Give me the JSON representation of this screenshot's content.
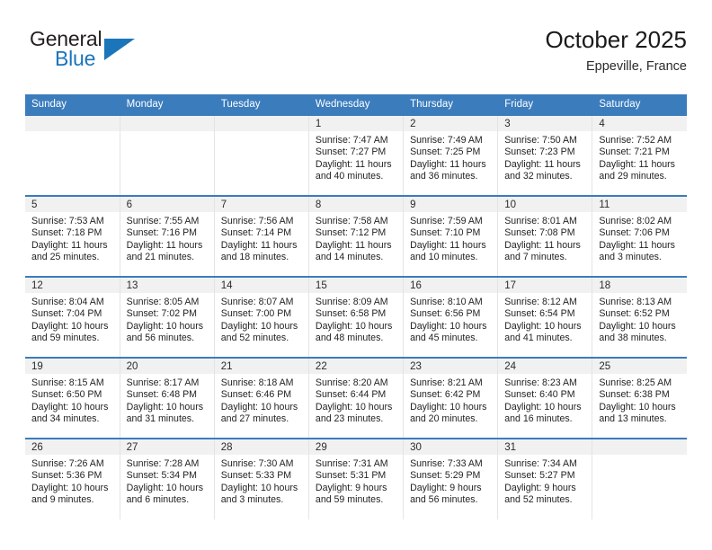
{
  "brand": {
    "name_top": "General",
    "name_bottom": "Blue",
    "color_dark": "#231f20",
    "color_blue": "#1b75bb"
  },
  "header": {
    "title": "October 2025",
    "subtitle": "Eppeville, France"
  },
  "theme": {
    "header_bg": "#3b7cbd",
    "header_text": "#ffffff",
    "daynum_band_bg": "#f1f1f1",
    "cell_bg": "#ffffff",
    "row_border": "#3b7cbd",
    "col_border": "#e4e4e4"
  },
  "weekdays": [
    "Sunday",
    "Monday",
    "Tuesday",
    "Wednesday",
    "Thursday",
    "Friday",
    "Saturday"
  ],
  "weeks": [
    [
      {
        "day": ""
      },
      {
        "day": ""
      },
      {
        "day": ""
      },
      {
        "day": "1",
        "sunrise": "Sunrise: 7:47 AM",
        "sunset": "Sunset: 7:27 PM",
        "daylight_l1": "Daylight: 11 hours",
        "daylight_l2": "and 40 minutes."
      },
      {
        "day": "2",
        "sunrise": "Sunrise: 7:49 AM",
        "sunset": "Sunset: 7:25 PM",
        "daylight_l1": "Daylight: 11 hours",
        "daylight_l2": "and 36 minutes."
      },
      {
        "day": "3",
        "sunrise": "Sunrise: 7:50 AM",
        "sunset": "Sunset: 7:23 PM",
        "daylight_l1": "Daylight: 11 hours",
        "daylight_l2": "and 32 minutes."
      },
      {
        "day": "4",
        "sunrise": "Sunrise: 7:52 AM",
        "sunset": "Sunset: 7:21 PM",
        "daylight_l1": "Daylight: 11 hours",
        "daylight_l2": "and 29 minutes."
      }
    ],
    [
      {
        "day": "5",
        "sunrise": "Sunrise: 7:53 AM",
        "sunset": "Sunset: 7:18 PM",
        "daylight_l1": "Daylight: 11 hours",
        "daylight_l2": "and 25 minutes."
      },
      {
        "day": "6",
        "sunrise": "Sunrise: 7:55 AM",
        "sunset": "Sunset: 7:16 PM",
        "daylight_l1": "Daylight: 11 hours",
        "daylight_l2": "and 21 minutes."
      },
      {
        "day": "7",
        "sunrise": "Sunrise: 7:56 AM",
        "sunset": "Sunset: 7:14 PM",
        "daylight_l1": "Daylight: 11 hours",
        "daylight_l2": "and 18 minutes."
      },
      {
        "day": "8",
        "sunrise": "Sunrise: 7:58 AM",
        "sunset": "Sunset: 7:12 PM",
        "daylight_l1": "Daylight: 11 hours",
        "daylight_l2": "and 14 minutes."
      },
      {
        "day": "9",
        "sunrise": "Sunrise: 7:59 AM",
        "sunset": "Sunset: 7:10 PM",
        "daylight_l1": "Daylight: 11 hours",
        "daylight_l2": "and 10 minutes."
      },
      {
        "day": "10",
        "sunrise": "Sunrise: 8:01 AM",
        "sunset": "Sunset: 7:08 PM",
        "daylight_l1": "Daylight: 11 hours",
        "daylight_l2": "and 7 minutes."
      },
      {
        "day": "11",
        "sunrise": "Sunrise: 8:02 AM",
        "sunset": "Sunset: 7:06 PM",
        "daylight_l1": "Daylight: 11 hours",
        "daylight_l2": "and 3 minutes."
      }
    ],
    [
      {
        "day": "12",
        "sunrise": "Sunrise: 8:04 AM",
        "sunset": "Sunset: 7:04 PM",
        "daylight_l1": "Daylight: 10 hours",
        "daylight_l2": "and 59 minutes."
      },
      {
        "day": "13",
        "sunrise": "Sunrise: 8:05 AM",
        "sunset": "Sunset: 7:02 PM",
        "daylight_l1": "Daylight: 10 hours",
        "daylight_l2": "and 56 minutes."
      },
      {
        "day": "14",
        "sunrise": "Sunrise: 8:07 AM",
        "sunset": "Sunset: 7:00 PM",
        "daylight_l1": "Daylight: 10 hours",
        "daylight_l2": "and 52 minutes."
      },
      {
        "day": "15",
        "sunrise": "Sunrise: 8:09 AM",
        "sunset": "Sunset: 6:58 PM",
        "daylight_l1": "Daylight: 10 hours",
        "daylight_l2": "and 48 minutes."
      },
      {
        "day": "16",
        "sunrise": "Sunrise: 8:10 AM",
        "sunset": "Sunset: 6:56 PM",
        "daylight_l1": "Daylight: 10 hours",
        "daylight_l2": "and 45 minutes."
      },
      {
        "day": "17",
        "sunrise": "Sunrise: 8:12 AM",
        "sunset": "Sunset: 6:54 PM",
        "daylight_l1": "Daylight: 10 hours",
        "daylight_l2": "and 41 minutes."
      },
      {
        "day": "18",
        "sunrise": "Sunrise: 8:13 AM",
        "sunset": "Sunset: 6:52 PM",
        "daylight_l1": "Daylight: 10 hours",
        "daylight_l2": "and 38 minutes."
      }
    ],
    [
      {
        "day": "19",
        "sunrise": "Sunrise: 8:15 AM",
        "sunset": "Sunset: 6:50 PM",
        "daylight_l1": "Daylight: 10 hours",
        "daylight_l2": "and 34 minutes."
      },
      {
        "day": "20",
        "sunrise": "Sunrise: 8:17 AM",
        "sunset": "Sunset: 6:48 PM",
        "daylight_l1": "Daylight: 10 hours",
        "daylight_l2": "and 31 minutes."
      },
      {
        "day": "21",
        "sunrise": "Sunrise: 8:18 AM",
        "sunset": "Sunset: 6:46 PM",
        "daylight_l1": "Daylight: 10 hours",
        "daylight_l2": "and 27 minutes."
      },
      {
        "day": "22",
        "sunrise": "Sunrise: 8:20 AM",
        "sunset": "Sunset: 6:44 PM",
        "daylight_l1": "Daylight: 10 hours",
        "daylight_l2": "and 23 minutes."
      },
      {
        "day": "23",
        "sunrise": "Sunrise: 8:21 AM",
        "sunset": "Sunset: 6:42 PM",
        "daylight_l1": "Daylight: 10 hours",
        "daylight_l2": "and 20 minutes."
      },
      {
        "day": "24",
        "sunrise": "Sunrise: 8:23 AM",
        "sunset": "Sunset: 6:40 PM",
        "daylight_l1": "Daylight: 10 hours",
        "daylight_l2": "and 16 minutes."
      },
      {
        "day": "25",
        "sunrise": "Sunrise: 8:25 AM",
        "sunset": "Sunset: 6:38 PM",
        "daylight_l1": "Daylight: 10 hours",
        "daylight_l2": "and 13 minutes."
      }
    ],
    [
      {
        "day": "26",
        "sunrise": "Sunrise: 7:26 AM",
        "sunset": "Sunset: 5:36 PM",
        "daylight_l1": "Daylight: 10 hours",
        "daylight_l2": "and 9 minutes."
      },
      {
        "day": "27",
        "sunrise": "Sunrise: 7:28 AM",
        "sunset": "Sunset: 5:34 PM",
        "daylight_l1": "Daylight: 10 hours",
        "daylight_l2": "and 6 minutes."
      },
      {
        "day": "28",
        "sunrise": "Sunrise: 7:30 AM",
        "sunset": "Sunset: 5:33 PM",
        "daylight_l1": "Daylight: 10 hours",
        "daylight_l2": "and 3 minutes."
      },
      {
        "day": "29",
        "sunrise": "Sunrise: 7:31 AM",
        "sunset": "Sunset: 5:31 PM",
        "daylight_l1": "Daylight: 9 hours",
        "daylight_l2": "and 59 minutes."
      },
      {
        "day": "30",
        "sunrise": "Sunrise: 7:33 AM",
        "sunset": "Sunset: 5:29 PM",
        "daylight_l1": "Daylight: 9 hours",
        "daylight_l2": "and 56 minutes."
      },
      {
        "day": "31",
        "sunrise": "Sunrise: 7:34 AM",
        "sunset": "Sunset: 5:27 PM",
        "daylight_l1": "Daylight: 9 hours",
        "daylight_l2": "and 52 minutes."
      },
      {
        "day": ""
      }
    ]
  ]
}
